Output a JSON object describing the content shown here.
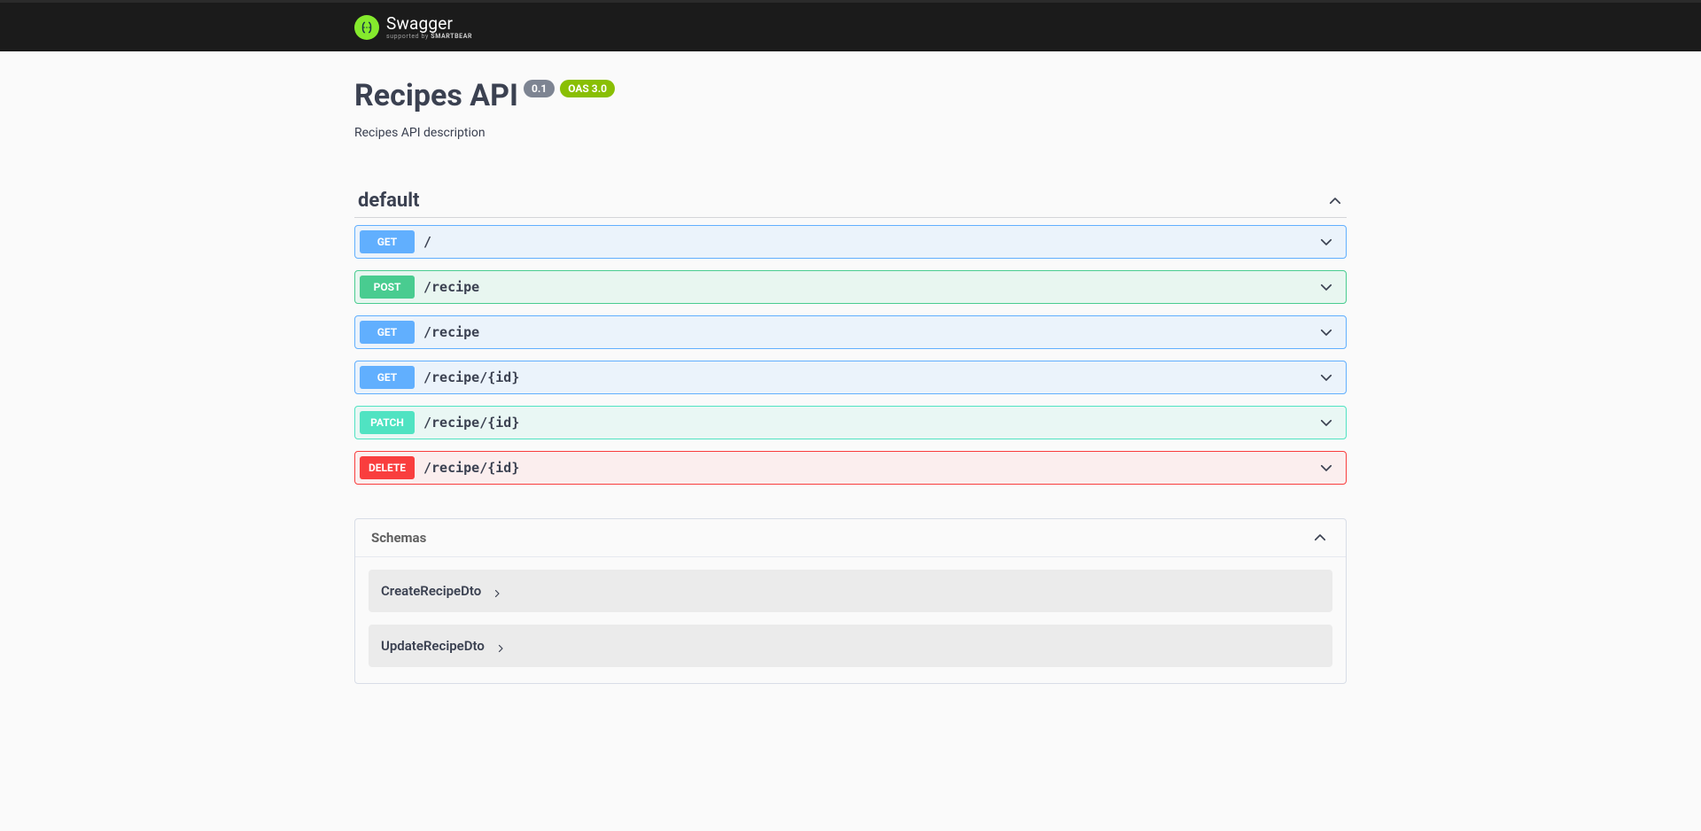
{
  "logo": {
    "main": "Swagger",
    "sub_prefix": "supported by ",
    "sub_brand": "SMARTBEAR"
  },
  "api": {
    "title": "Recipes API",
    "version": "0.1",
    "oas": "OAS 3.0",
    "description": "Recipes API description"
  },
  "tag": {
    "name": "default"
  },
  "operations": [
    {
      "method": "GET",
      "css": "op-get",
      "path": "/"
    },
    {
      "method": "POST",
      "css": "op-post",
      "path": "/recipe"
    },
    {
      "method": "GET",
      "css": "op-get",
      "path": "/recipe"
    },
    {
      "method": "GET",
      "css": "op-get",
      "path": "/recipe/{id}"
    },
    {
      "method": "PATCH",
      "css": "op-patch",
      "path": "/recipe/{id}"
    },
    {
      "method": "DELETE",
      "css": "op-delete",
      "path": "/recipe/{id}"
    }
  ],
  "schemas": {
    "title": "Schemas",
    "items": [
      {
        "name": "CreateRecipeDto"
      },
      {
        "name": "UpdateRecipeDto"
      }
    ]
  },
  "colors": {
    "get": "#61affe",
    "post": "#49cc90",
    "patch": "#50e3c2",
    "delete": "#f93e3e",
    "oas_badge": "#89bf04",
    "ver_badge": "#7d8492"
  }
}
